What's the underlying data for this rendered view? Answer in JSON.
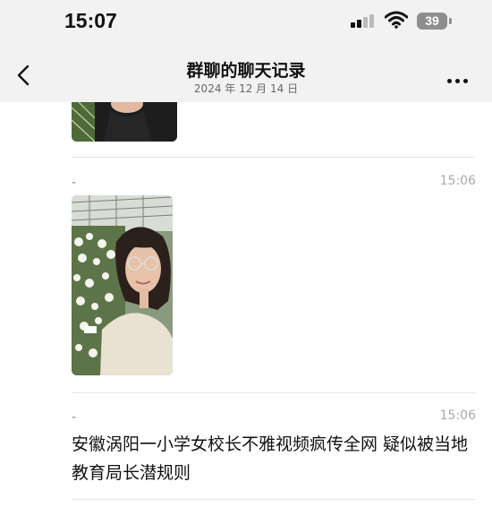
{
  "status_bar": {
    "time": "15:07",
    "battery": "39",
    "signal_icon": "cellular-signal-icon",
    "wifi_icon": "wifi-icon"
  },
  "header": {
    "title": "群聊的聊天记录",
    "date": "2024 年 12 月 14 日",
    "back_icon": "chevron-left-icon",
    "more_icon": "more-dots-icon"
  },
  "messages": [
    {
      "sender": "-",
      "time": "15:06",
      "type": "image",
      "image_description_icon": "photo-icon"
    },
    {
      "sender": "-",
      "time": "15:06",
      "type": "text",
      "text": "安徽涡阳一小学女校长不雅视频疯传全网 疑似被当地教育局长潜规则"
    }
  ],
  "colors": {
    "bar_background": "#f2f2f2",
    "meta_text": "#aaaaaa",
    "divider": "#e6e6e6"
  }
}
